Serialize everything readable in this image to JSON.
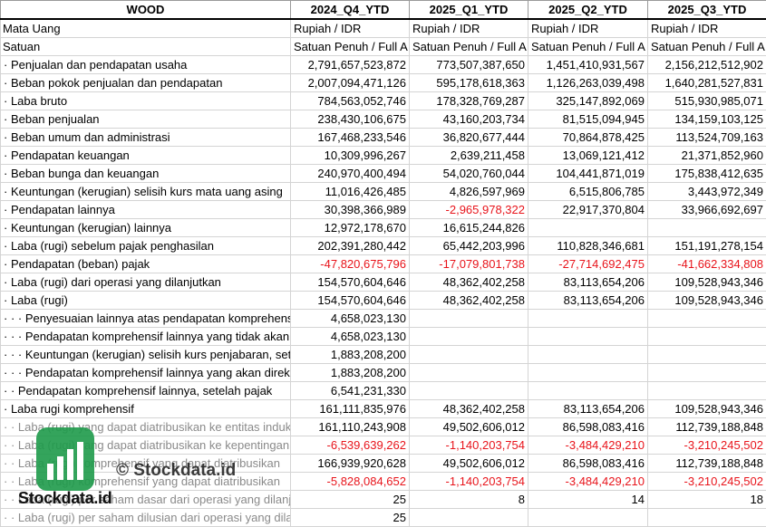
{
  "table": {
    "header": [
      "WOOD",
      "2024_Q4_YTD",
      "2025_Q1_YTD",
      "2025_Q2_YTD",
      "2025_Q3_YTD"
    ],
    "meta_rows": [
      {
        "label": "Mata Uang",
        "values": [
          "Rupiah / IDR",
          "Rupiah / IDR",
          "Rupiah / IDR",
          "Rupiah / IDR"
        ]
      },
      {
        "label": "Satuan",
        "values": [
          "Satuan Penuh / Full A",
          "Satuan Penuh / Full A",
          "Satuan Penuh / Full A",
          "Satuan Penuh / Full A"
        ]
      }
    ],
    "rows": [
      {
        "label": "· Penjualan dan pendapatan usaha",
        "values": [
          "2,791,657,523,872",
          "773,507,387,650",
          "1,451,410,931,567",
          "2,156,212,512,902"
        ]
      },
      {
        "label": "· Beban pokok penjualan dan pendapatan",
        "values": [
          "2,007,094,471,126",
          "595,178,618,363",
          "1,126,263,039,498",
          "1,640,281,527,831"
        ]
      },
      {
        "label": "· Laba bruto",
        "values": [
          "784,563,052,746",
          "178,328,769,287",
          "325,147,892,069",
          "515,930,985,071"
        ]
      },
      {
        "label": "· Beban penjualan",
        "values": [
          "238,430,106,675",
          "43,160,203,734",
          "81,515,094,945",
          "134,159,103,125"
        ]
      },
      {
        "label": "· Beban umum dan administrasi",
        "values": [
          "167,468,233,546",
          "36,820,677,444",
          "70,864,878,425",
          "113,524,709,163"
        ]
      },
      {
        "label": "· Pendapatan keuangan",
        "values": [
          "10,309,996,267",
          "2,639,211,458",
          "13,069,121,412",
          "21,371,852,960"
        ]
      },
      {
        "label": "· Beban bunga dan keuangan",
        "values": [
          "240,970,400,494",
          "54,020,760,044",
          "104,441,871,019",
          "175,838,412,635"
        ]
      },
      {
        "label": "· Keuntungan (kerugian) selisih kurs mata uang asing",
        "values": [
          "11,016,426,485",
          "4,826,597,969",
          "6,515,806,785",
          "3,443,972,349"
        ]
      },
      {
        "label": "· Pendapatan lainnya",
        "values": [
          "30,398,366,989",
          "-2,965,978,322",
          "22,917,370,804",
          "33,966,692,697"
        ]
      },
      {
        "label": "· Keuntungan (kerugian) lainnya",
        "values": [
          "12,972,178,670",
          "16,615,244,826",
          "",
          ""
        ]
      },
      {
        "label": "· Laba (rugi) sebelum pajak penghasilan",
        "values": [
          "202,391,280,442",
          "65,442,203,996",
          "110,828,346,681",
          "151,191,278,154"
        ]
      },
      {
        "label": "· Pendapatan (beban) pajak",
        "values": [
          "-47,820,675,796",
          "-17,079,801,738",
          "-27,714,692,475",
          "-41,662,334,808"
        ]
      },
      {
        "label": "· Laba (rugi) dari operasi yang dilanjutkan",
        "values": [
          "154,570,604,646",
          "48,362,402,258",
          "83,113,654,206",
          "109,528,943,346"
        ]
      },
      {
        "label": "· Laba (rugi)",
        "values": [
          "154,570,604,646",
          "48,362,402,258",
          "83,113,654,206",
          "109,528,943,346"
        ]
      },
      {
        "label": "· · · Penyesuaian lainnya atas pendapatan komprehensif",
        "values": [
          "4,658,023,130",
          "",
          "",
          ""
        ]
      },
      {
        "label": "· · · Pendapatan komprehensif lainnya yang tidak akan",
        "values": [
          "4,658,023,130",
          "",
          "",
          ""
        ]
      },
      {
        "label": "· · · Keuntungan (kerugian) selisih kurs penjabaran, setelah",
        "values": [
          "1,883,208,200",
          "",
          "",
          ""
        ]
      },
      {
        "label": "· · · Pendapatan komprehensif lainnya yang akan direklasifikasi",
        "values": [
          "1,883,208,200",
          "",
          "",
          ""
        ]
      },
      {
        "label": "· · Pendapatan komprehensif lainnya, setelah pajak",
        "values": [
          "6,541,231,330",
          "",
          "",
          ""
        ]
      },
      {
        "label": "· Laba rugi komprehensif",
        "values": [
          "161,111,835,976",
          "48,362,402,258",
          "83,113,654,206",
          "109,528,943,346"
        ]
      },
      {
        "label": "· · Laba (rugi) yang dapat diatribusikan ke entitas induk",
        "gray": true,
        "values": [
          "161,110,243,908",
          "49,502,606,012",
          "86,598,083,416",
          "112,739,188,848"
        ]
      },
      {
        "label": "· · Laba (rugi) yang dapat diatribusikan ke kepentingan",
        "gray": true,
        "values": [
          "-6,539,639,262",
          "-1,140,203,754",
          "-3,484,429,210",
          "-3,210,245,502"
        ]
      },
      {
        "label": "· · Laba (rugi) komprehensif yang dapat diatribusikan",
        "gray": true,
        "values": [
          "166,939,920,628",
          "49,502,606,012",
          "86,598,083,416",
          "112,739,188,848"
        ]
      },
      {
        "label": "· · Laba (rugi) komprehensif yang dapat diatribusikan",
        "gray": true,
        "values": [
          "-5,828,084,652",
          "-1,140,203,754",
          "-3,484,429,210",
          "-3,210,245,502"
        ]
      },
      {
        "label": "· · Laba (rugi) per saham dasar dari operasi yang dilanjutkan",
        "gray": true,
        "values": [
          "25",
          "8",
          "14",
          "18"
        ]
      },
      {
        "label": "· · Laba (rugi) per saham dilusian dari operasi yang dilanjutkan",
        "gray": true,
        "values": [
          "25",
          "",
          "",
          ""
        ]
      }
    ]
  },
  "watermark": {
    "text": "© Stockdata.id",
    "brand": "Stockdata.id",
    "logo_color": "#1e9a4a",
    "icon": "bar-chart-logo-icon"
  },
  "colors": {
    "negative": "#e8141b",
    "gray_label": "#8a8a8a"
  }
}
